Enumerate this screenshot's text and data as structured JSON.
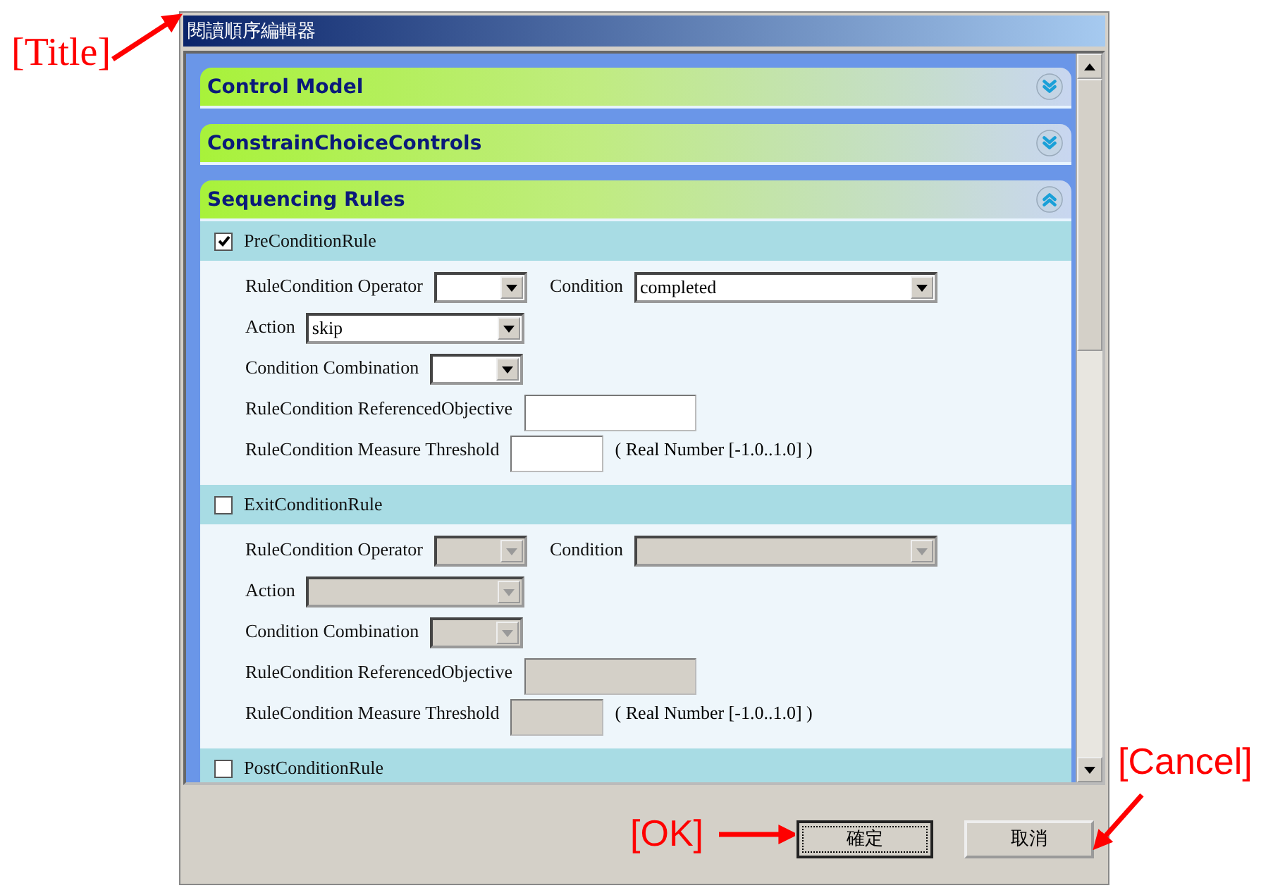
{
  "window": {
    "title": "閱讀順序編輯器"
  },
  "sections": [
    {
      "title": "Control Model",
      "expanded": false
    },
    {
      "title": "ConstrainChoiceControls",
      "expanded": false
    },
    {
      "title": "Sequencing Rules",
      "expanded": true,
      "rules": [
        {
          "label": "PreConditionRule",
          "checked": true,
          "rows": [
            [
              {
                "kind": "select",
                "label": "RuleCondition Operator"
              },
              {
                "kind": "select",
                "label": "Condition",
                "value": "completed"
              }
            ],
            [
              {
                "kind": "select",
                "label": "Action",
                "value": "skip"
              }
            ],
            [
              {
                "kind": "select",
                "label": "Condition Combination"
              }
            ],
            [
              {
                "kind": "input",
                "label": "RuleCondition ReferencedObjective"
              }
            ],
            [
              {
                "kind": "input",
                "label": "RuleCondition Measure  Threshold",
                "note": "( Real Number [-1.0..1.0] )"
              }
            ]
          ]
        },
        {
          "label": "ExitConditionRule",
          "checked": false,
          "rows": [
            [
              {
                "kind": "select",
                "label": "RuleCondition Operator"
              },
              {
                "kind": "select",
                "label": "Condition"
              }
            ],
            [
              {
                "kind": "select",
                "label": "Action"
              }
            ],
            [
              {
                "kind": "select",
                "label": "Condition Combination"
              }
            ],
            [
              {
                "kind": "input",
                "label": "RuleCondition ReferencedObjective"
              }
            ],
            [
              {
                "kind": "input",
                "label": "RuleCondition Measure  Threshold",
                "note": "( Real Number [-1.0..1.0] )"
              }
            ]
          ]
        },
        {
          "label": "PostConditionRule",
          "checked": false
        }
      ]
    }
  ],
  "buttons": [
    {
      "label": "確定",
      "default": true
    },
    {
      "label": "取消",
      "default": false
    }
  ],
  "annotations": [
    {
      "kind": "title",
      "text": "[Title]"
    },
    {
      "kind": "ok",
      "text": "[OK]"
    },
    {
      "kind": "cancel",
      "text": "[Cancel]"
    }
  ]
}
